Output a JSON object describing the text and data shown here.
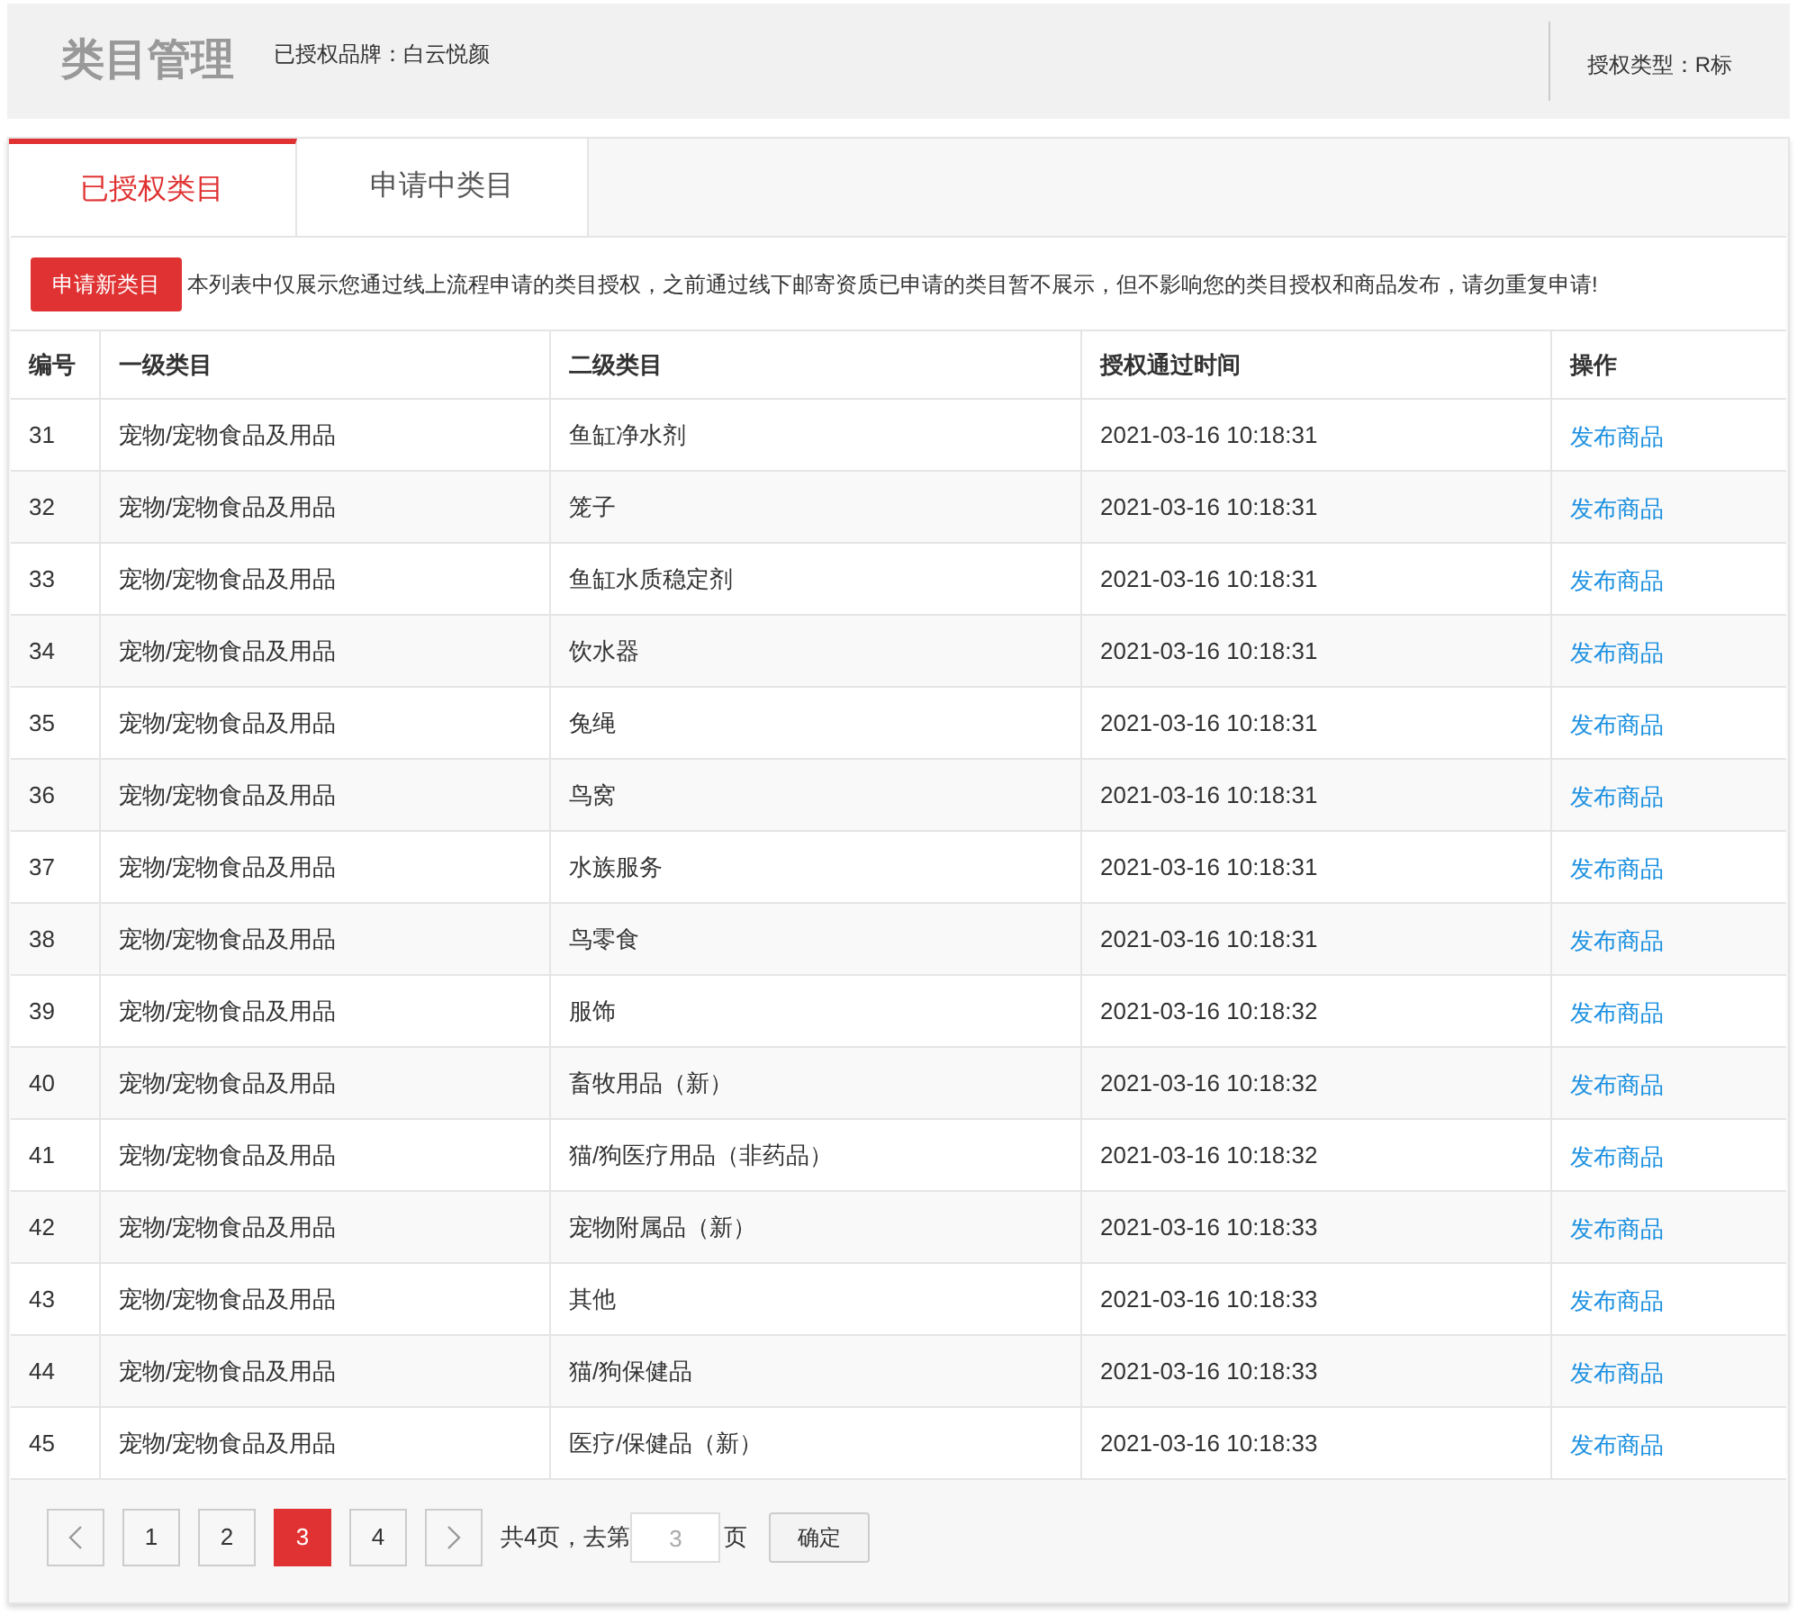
{
  "header": {
    "title": "类目管理",
    "brand": "已授权品牌：白云悦颜",
    "auth_type": "授权类型：R标"
  },
  "tabs": [
    {
      "label": "已授权类目",
      "selected": true
    },
    {
      "label": "申请中类目",
      "selected": false
    }
  ],
  "apply_button": "申请新类目",
  "notice": "本列表中仅展示您通过线上流程申请的类目授权，之前通过线下邮寄资质已申请的类目暂不展示，但不影响您的类目授权和商品发布，请勿重复申请!",
  "table": {
    "columns": [
      "编号",
      "一级类目",
      "二级类目",
      "授权通过时间",
      "操作"
    ],
    "rows": [
      {
        "id": "31",
        "level1": "宠物/宠物食品及用品",
        "level2": "鱼缸净水剂",
        "time": "2021-03-16 10:18:31",
        "action": "发布商品"
      },
      {
        "id": "32",
        "level1": "宠物/宠物食品及用品",
        "level2": "笼子",
        "time": "2021-03-16 10:18:31",
        "action": "发布商品"
      },
      {
        "id": "33",
        "level1": "宠物/宠物食品及用品",
        "level2": "鱼缸水质稳定剂",
        "time": "2021-03-16 10:18:31",
        "action": "发布商品"
      },
      {
        "id": "34",
        "level1": "宠物/宠物食品及用品",
        "level2": "饮水器",
        "time": "2021-03-16 10:18:31",
        "action": "发布商品"
      },
      {
        "id": "35",
        "level1": "宠物/宠物食品及用品",
        "level2": "兔绳",
        "time": "2021-03-16 10:18:31",
        "action": "发布商品"
      },
      {
        "id": "36",
        "level1": "宠物/宠物食品及用品",
        "level2": "鸟窝",
        "time": "2021-03-16 10:18:31",
        "action": "发布商品"
      },
      {
        "id": "37",
        "level1": "宠物/宠物食品及用品",
        "level2": "水族服务",
        "time": "2021-03-16 10:18:31",
        "action": "发布商品"
      },
      {
        "id": "38",
        "level1": "宠物/宠物食品及用品",
        "level2": "鸟零食",
        "time": "2021-03-16 10:18:31",
        "action": "发布商品"
      },
      {
        "id": "39",
        "level1": "宠物/宠物食品及用品",
        "level2": "服饰",
        "time": "2021-03-16 10:18:32",
        "action": "发布商品"
      },
      {
        "id": "40",
        "level1": "宠物/宠物食品及用品",
        "level2": "畜牧用品（新）",
        "time": "2021-03-16 10:18:32",
        "action": "发布商品"
      },
      {
        "id": "41",
        "level1": "宠物/宠物食品及用品",
        "level2": "猫/狗医疗用品（非药品）",
        "time": "2021-03-16 10:18:32",
        "action": "发布商品"
      },
      {
        "id": "42",
        "level1": "宠物/宠物食品及用品",
        "level2": "宠物附属品（新）",
        "time": "2021-03-16 10:18:33",
        "action": "发布商品"
      },
      {
        "id": "43",
        "level1": "宠物/宠物食品及用品",
        "level2": "其他",
        "time": "2021-03-16 10:18:33",
        "action": "发布商品"
      },
      {
        "id": "44",
        "level1": "宠物/宠物食品及用品",
        "level2": "猫/狗保健品",
        "time": "2021-03-16 10:18:33",
        "action": "发布商品"
      },
      {
        "id": "45",
        "level1": "宠物/宠物食品及用品",
        "level2": "医疗/保健品（新）",
        "time": "2021-03-16 10:18:33",
        "action": "发布商品"
      }
    ]
  },
  "pagination": {
    "pages": [
      {
        "label": "1",
        "selected": false
      },
      {
        "label": "2",
        "selected": false
      },
      {
        "label": "3",
        "selected": true
      },
      {
        "label": "4",
        "selected": false
      }
    ],
    "total": "共4页，去第",
    "page_input": {
      "placeholder": "3"
    },
    "suffix": "页",
    "confirm": "确定"
  }
}
